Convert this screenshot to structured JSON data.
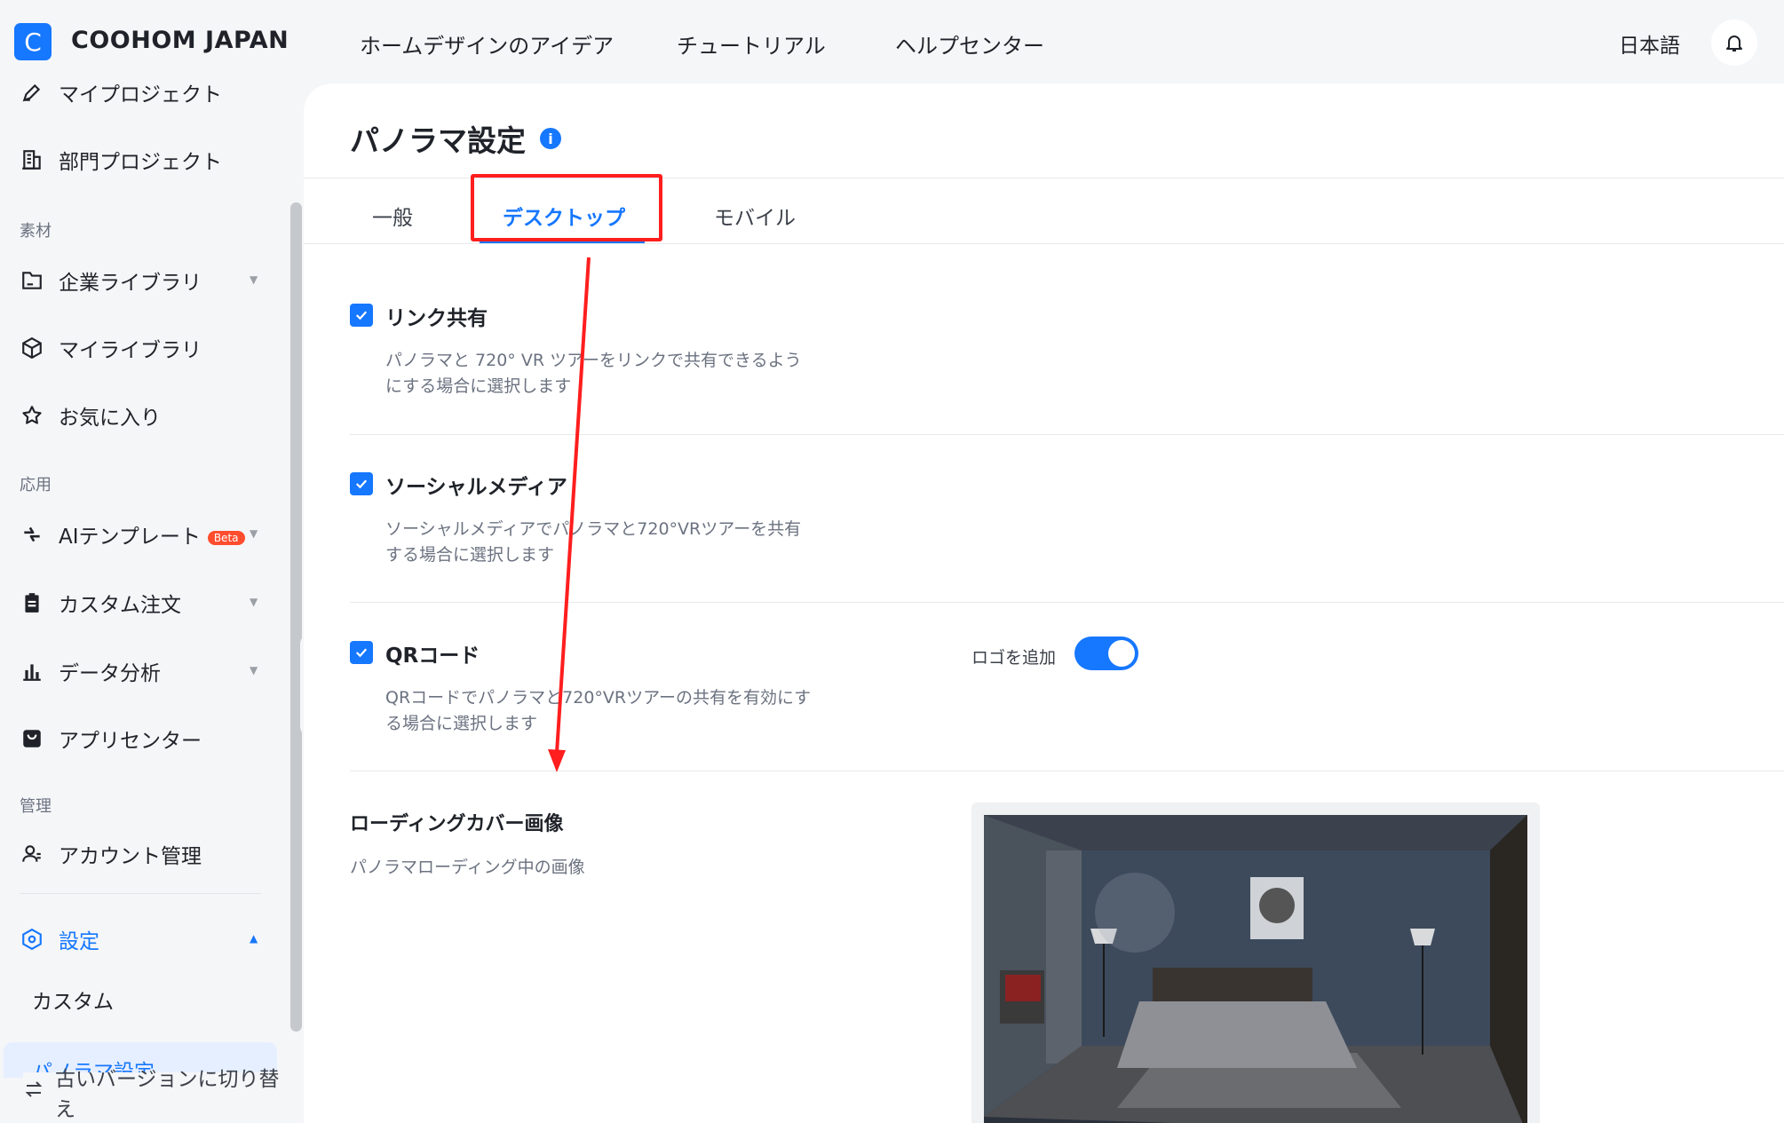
{
  "header": {
    "logo_letter": "C",
    "brand": "COOHOM JAPAN",
    "nav": [
      "ホームデザインのアイデア",
      "チュートリアル",
      "ヘルプセンター"
    ],
    "language": "日本語",
    "bell_icon": "bell-icon"
  },
  "sidebar": {
    "items_top": [
      {
        "label": "マイプロジェクト",
        "icon": "edit-project-icon"
      },
      {
        "label": "部門プロジェクト",
        "icon": "building-icon"
      }
    ],
    "section_materials": "素材",
    "items_materials": [
      {
        "label": "企業ライブラリ",
        "icon": "folder-icon"
      },
      {
        "label": "マイライブラリ",
        "icon": "cube-icon"
      },
      {
        "label": "お気に入り",
        "icon": "star-icon"
      }
    ],
    "section_apps": "応用",
    "items_apps": [
      {
        "label": "AIテンプレート",
        "icon": "bolt-icon",
        "badge": "Beta"
      },
      {
        "label": "カスタム注文",
        "icon": "clipboard-icon"
      },
      {
        "label": "データ分析",
        "icon": "bar-chart-icon"
      },
      {
        "label": "アプリセンター",
        "icon": "app-bag-icon"
      }
    ],
    "section_admin": "管理",
    "items_admin": [
      {
        "label": "アカウント管理",
        "icon": "user-manage-icon"
      }
    ],
    "settings_label": "設定",
    "sub_custom": "カスタム",
    "sub_active": "パノラマ設定",
    "switch_version": "古いバージョンに切り替え"
  },
  "page": {
    "title": "パノラマ設定",
    "info_icon": "i",
    "tabs": [
      "一般",
      "デスクトップ",
      "モバイル"
    ],
    "active_tab": "デスクトップ",
    "options": [
      {
        "title": "リンク共有",
        "desc": "パノラマと 720° VR ツアーをリンクで共有できるようにする場合に選択します",
        "checked": true
      },
      {
        "title": "ソーシャルメディア",
        "desc": "ソーシャルメディアでパノラマと720°VRツアーを共有する場合に選択します",
        "checked": true
      },
      {
        "title": "QRコード",
        "desc": "QRコードでパノラマと720°VRツアーの共有を有効にする場合に選択します",
        "checked": true
      }
    ],
    "logo_add_label": "ロゴを追加",
    "logo_add_on": true,
    "cover_title": "ローディングカバー画像",
    "cover_desc": "パノラマローディング中の画像"
  },
  "colors": {
    "accent": "#1677ff",
    "annotation_red": "#ff1e1e",
    "beta_badge": "#ff4d2e"
  }
}
